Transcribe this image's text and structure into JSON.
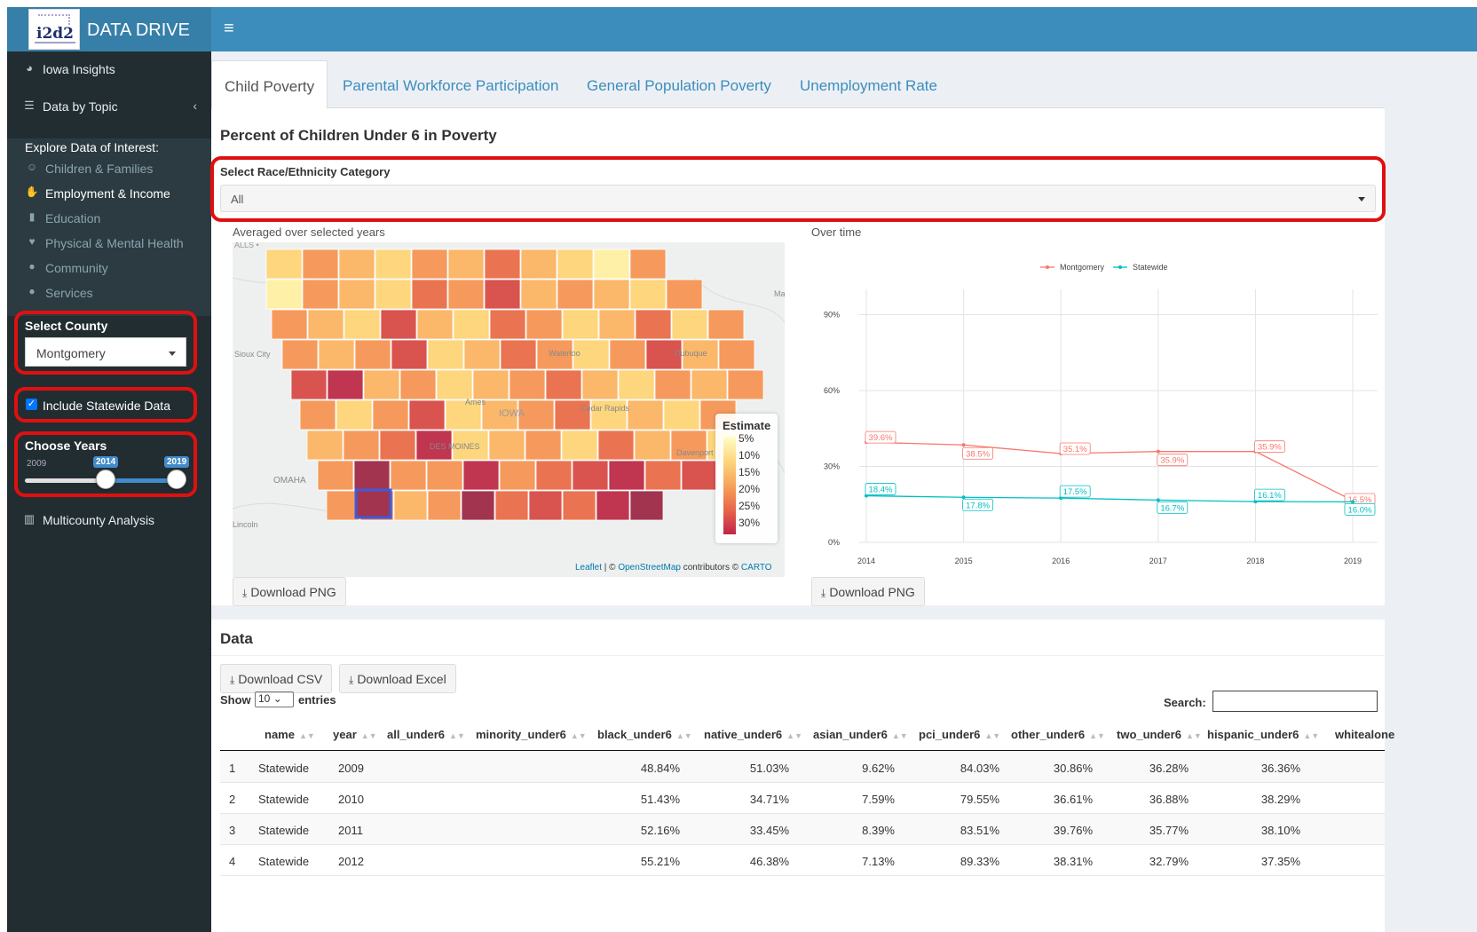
{
  "app": {
    "title": "DATA DRIVE",
    "logo_text": "i2d2"
  },
  "sidebar": {
    "items": [
      {
        "label": "Iowa Insights",
        "icon": "dashboard-icon"
      },
      {
        "label": "Data by Topic",
        "icon": "database-icon"
      },
      {
        "label": "Multicounty Analysis",
        "icon": "bar-chart-icon"
      }
    ],
    "explore_header": "Explore Data of Interest:",
    "subitems": [
      {
        "label": "Children & Families",
        "icon": "child-icon"
      },
      {
        "label": "Employment & Income",
        "icon": "hand-coin-icon"
      },
      {
        "label": "Education",
        "icon": "book-icon"
      },
      {
        "label": "Physical & Mental Health",
        "icon": "heartbeat-icon"
      },
      {
        "label": "Community",
        "icon": "users-icon"
      },
      {
        "label": "Services",
        "icon": "user-cog-icon"
      }
    ],
    "county_label": "Select County",
    "county_value": "Montgomery",
    "statewide_label": "Include Statewide Data",
    "years_label": "Choose Years",
    "years_min": "2009",
    "years_from": "2014",
    "years_to": "2019"
  },
  "tabs": [
    "Child Poverty",
    "Parental Workforce Participation",
    "General Population Poverty",
    "Unemployment Rate"
  ],
  "box_title": "Percent of Children Under 6 in Poverty",
  "race_label": "Select Race/Ethnicity Category",
  "race_value": "All",
  "map": {
    "caption": "Averaged over selected years",
    "labels": [
      "Sioux City",
      "Ames",
      "IOWA",
      "Cedar Rapids",
      "Waterloo",
      "Dubuque",
      "DES MOINES",
      "Davenport",
      "OMAHA",
      "Lincoln",
      "Ma"
    ],
    "legend_title": "Estimate",
    "legend_ticks": [
      "5%",
      "10%",
      "15%",
      "20%",
      "25%",
      "30%"
    ],
    "attribution": {
      "leaflet": "Leaflet",
      "osm": "OpenStreetMap",
      "contributors": "contributors ©",
      "carto": "CARTO"
    }
  },
  "chart": {
    "caption": "Over time"
  },
  "chart_data": {
    "type": "line",
    "x": [
      2014,
      2015,
      2016,
      2017,
      2018,
      2019
    ],
    "series": [
      {
        "name": "Montgomery",
        "values": [
          39.6,
          38.5,
          35.1,
          35.9,
          35.9,
          16.5
        ],
        "labels": [
          "39.6%",
          "38.5%",
          "35.1%",
          "35.9%",
          "35.9%",
          "16.5%"
        ],
        "color": "#f8766d"
      },
      {
        "name": "Statewide",
        "values": [
          18.4,
          17.8,
          17.5,
          16.7,
          16.1,
          16.0
        ],
        "labels": [
          "18.4%",
          "17.8%",
          "17.5%",
          "16.7%",
          "16.1%",
          "16.0%"
        ],
        "color": "#00bfc4"
      }
    ],
    "ylim": [
      0,
      100
    ],
    "yticks": [
      0,
      30,
      60,
      90
    ],
    "ytick_labels": [
      "0%",
      "30%",
      "60%",
      "90%"
    ],
    "xtick_labels": [
      "2014",
      "2015",
      "2016",
      "2017",
      "2018",
      "2019"
    ],
    "grid": true,
    "legend": "top"
  },
  "download_png": "Download PNG",
  "data": {
    "title": "Data",
    "download_csv": "Download CSV",
    "download_excel": "Download Excel",
    "show": "Show",
    "show_value": "10",
    "entries": "entries",
    "search_label": "Search:",
    "columns": [
      "name",
      "year",
      "all_under6",
      "minority_under6",
      "black_under6",
      "native_under6",
      "asian_under6",
      "pci_under6",
      "other_under6",
      "two_under6",
      "hispanic_under6",
      "whitealone"
    ],
    "rows": [
      [
        "1",
        "Statewide",
        "2009",
        "48.84%",
        "51.03%",
        "9.62%",
        "84.03%",
        "30.86%",
        "36.28%",
        "36.36%"
      ],
      [
        "2",
        "Statewide",
        "2010",
        "51.43%",
        "34.71%",
        "7.59%",
        "79.55%",
        "36.61%",
        "36.88%",
        "38.29%"
      ],
      [
        "3",
        "Statewide",
        "2011",
        "52.16%",
        "33.45%",
        "8.39%",
        "83.51%",
        "39.76%",
        "35.77%",
        "38.10%"
      ],
      [
        "4",
        "Statewide",
        "2012",
        "55.21%",
        "46.38%",
        "7.13%",
        "89.33%",
        "38.31%",
        "32.79%",
        "37.35%"
      ]
    ]
  },
  "colors": {
    "header": "#3c8dbc",
    "sidebar": "#222d32",
    "highlight": "#e01010",
    "link": "#3c8dbc"
  }
}
